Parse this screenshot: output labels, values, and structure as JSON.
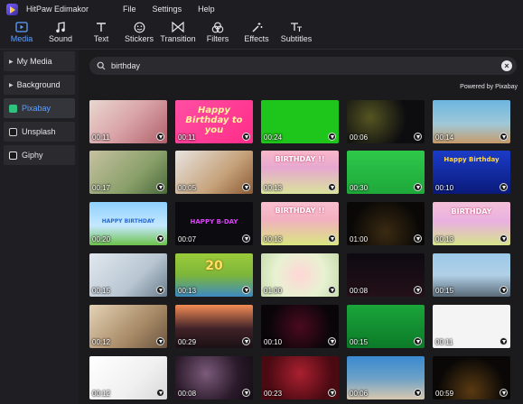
{
  "app": {
    "name": "HitPaw Edimakor"
  },
  "menu": [
    "File",
    "Settings",
    "Help"
  ],
  "tabs": [
    {
      "label": "Media",
      "icon": "media-icon",
      "active": true
    },
    {
      "label": "Sound",
      "icon": "music-note-icon",
      "active": false
    },
    {
      "label": "Text",
      "icon": "text-icon",
      "active": false
    },
    {
      "label": "Stickers",
      "icon": "sticker-icon",
      "active": false
    },
    {
      "label": "Transition",
      "icon": "transition-icon",
      "active": false
    },
    {
      "label": "Filters",
      "icon": "filters-icon",
      "active": false
    },
    {
      "label": "Effects",
      "icon": "effects-wand-icon",
      "active": false
    },
    {
      "label": "Subtitles",
      "icon": "subtitles-icon",
      "active": false
    }
  ],
  "sidebar": {
    "items": [
      {
        "label": "My Media",
        "type": "expandable"
      },
      {
        "label": "Background",
        "type": "expandable"
      },
      {
        "label": "Pixabay",
        "type": "source",
        "active": true
      },
      {
        "label": "Unsplash",
        "type": "source"
      },
      {
        "label": "Giphy",
        "type": "source"
      }
    ]
  },
  "search": {
    "value": "birthday",
    "placeholder": "Search"
  },
  "powered_by": "Powered by Pixabay",
  "thumbnails": [
    {
      "duration": "00:11",
      "text": ""
    },
    {
      "duration": "00:11",
      "text": "Happy Birthday to you"
    },
    {
      "duration": "00:24",
      "text": ""
    },
    {
      "duration": "00:06",
      "text": ""
    },
    {
      "duration": "00:14",
      "text": ""
    },
    {
      "duration": "00:17",
      "text": ""
    },
    {
      "duration": "00:05",
      "text": ""
    },
    {
      "duration": "00:13",
      "text": "BIRTHDAY !!"
    },
    {
      "duration": "00:30",
      "text": ""
    },
    {
      "duration": "00:10",
      "text": "Happy Birthday"
    },
    {
      "duration": "00:20",
      "text": "HAPPY BIRTHDAY"
    },
    {
      "duration": "00:07",
      "text": "HAPPY B-DAY"
    },
    {
      "duration": "00:13",
      "text": "BIRTHDAY !!"
    },
    {
      "duration": "01:00",
      "text": ""
    },
    {
      "duration": "00:13",
      "text": "BIRTHDAY"
    },
    {
      "duration": "00:15",
      "text": ""
    },
    {
      "duration": "00:13",
      "text": "20"
    },
    {
      "duration": "01:00",
      "text": ""
    },
    {
      "duration": "00:08",
      "text": ""
    },
    {
      "duration": "00:15",
      "text": ""
    },
    {
      "duration": "00:12",
      "text": ""
    },
    {
      "duration": "00:29",
      "text": ""
    },
    {
      "duration": "00:10",
      "text": ""
    },
    {
      "duration": "00:15",
      "text": ""
    },
    {
      "duration": "00:11",
      "text": ""
    },
    {
      "duration": "00:12",
      "text": ""
    },
    {
      "duration": "00:08",
      "text": ""
    },
    {
      "duration": "00:23",
      "text": ""
    },
    {
      "duration": "00:06",
      "text": ""
    },
    {
      "duration": "00:59",
      "text": ""
    }
  ],
  "colors": {
    "accent": "#5ea0ff",
    "background": "#1b1b1e",
    "panel": "#1f1f23"
  }
}
